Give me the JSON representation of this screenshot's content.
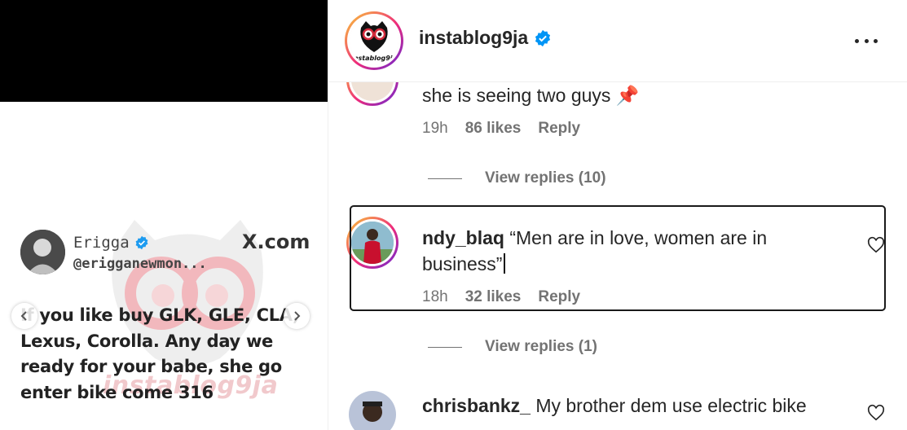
{
  "post": {
    "tweet": {
      "name": "Erigga",
      "handle": "@erigganewmon...",
      "source": "X.com",
      "text": "If you like buy GLK, GLE, CLA, Lexus, Corolla. Any day we ready for your babe, she go enter bike come 316"
    },
    "watermark": "instablog9ja"
  },
  "header": {
    "username": "instablog9ja",
    "verified_icon": "verified-badge-icon",
    "more_icon": "more-options-icon"
  },
  "comments": [
    {
      "text": "she is seeing two guys",
      "emoji": "📌",
      "time": "19h",
      "likes": "86 likes",
      "reply": "Reply",
      "view_replies": "View replies (10)"
    },
    {
      "username": "ndy_blaq",
      "text_line1": "“Men are in love, women are in",
      "text_line2": "business”",
      "time": "18h",
      "likes": "32 likes",
      "reply": "Reply",
      "view_replies": "View replies (1)"
    },
    {
      "username": "chrisbankz_",
      "text": "My brother dem use electric bike"
    }
  ],
  "colors": {
    "verified": "#0095f6",
    "muted": "#737373",
    "text": "#262626",
    "ring_start": "#f9ce34",
    "ring_mid": "#ee2a7b",
    "ring_end": "#6228d7"
  }
}
